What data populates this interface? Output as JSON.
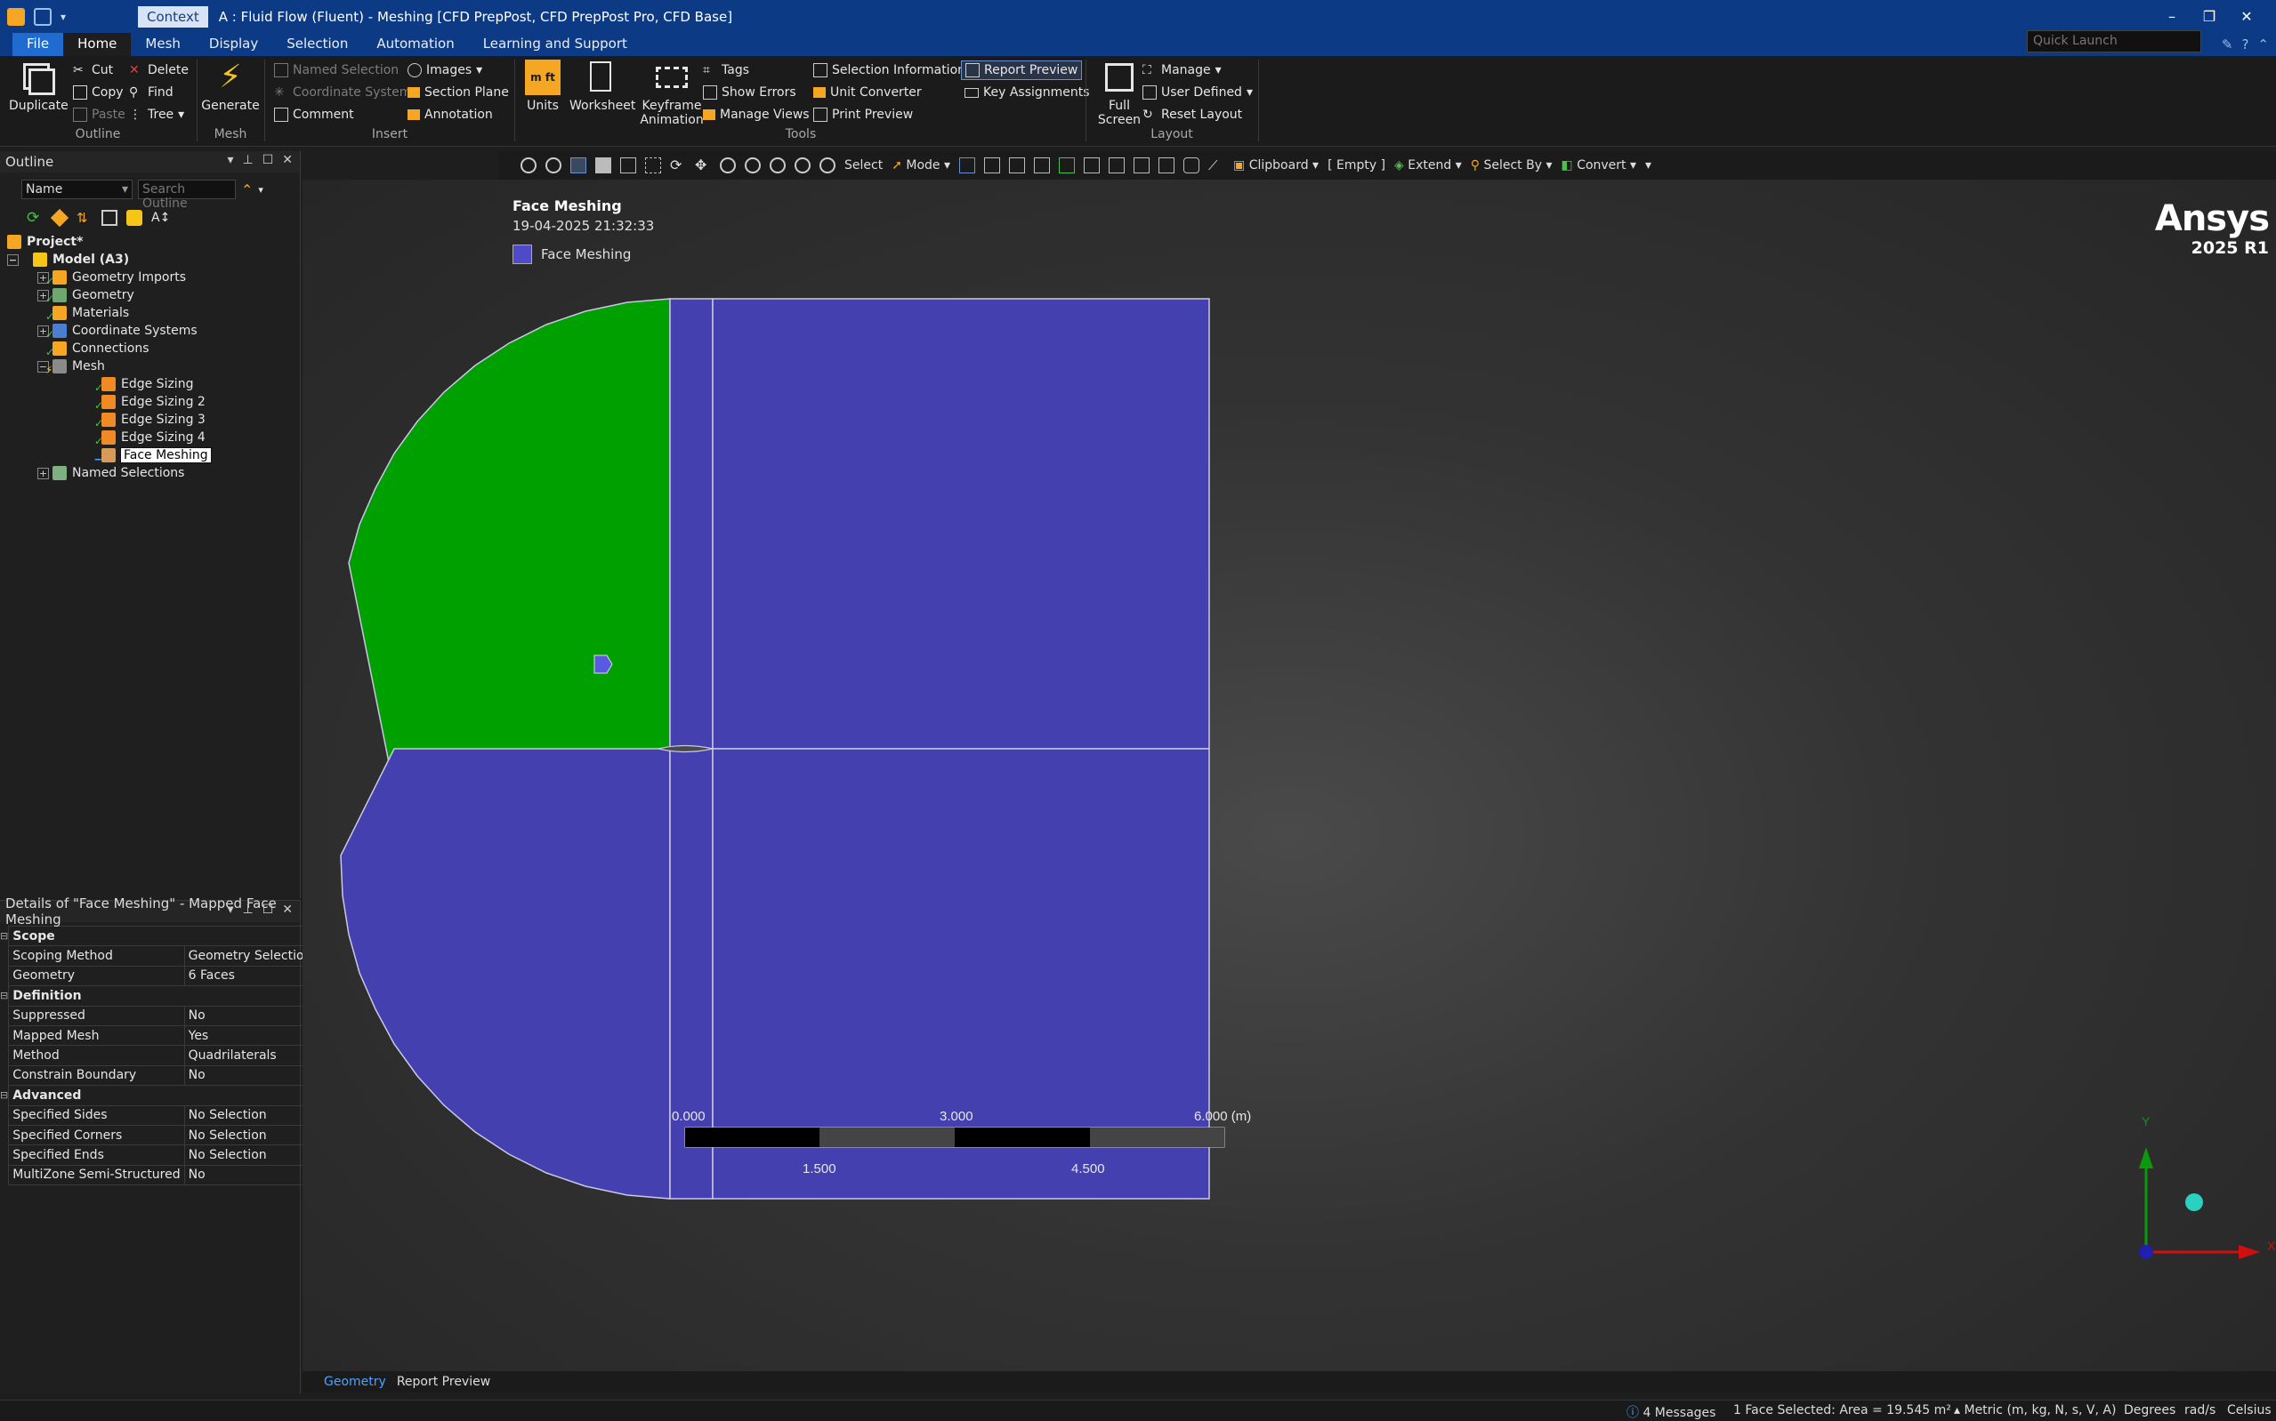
{
  "window": {
    "context": "Context",
    "title": "A : Fluid Flow (Fluent) - Meshing [CFD PrepPost, CFD PrepPost Pro, CFD Base]",
    "minimize": "–",
    "restore": "❐",
    "close": "✕"
  },
  "tabs": [
    "File",
    "Home",
    "Mesh",
    "Display",
    "Selection",
    "Automation",
    "Learning and Support"
  ],
  "quick_launch": {
    "placeholder": "Quick Launch"
  },
  "ribbon": {
    "outline": {
      "label": "Outline",
      "duplicate": "Duplicate",
      "cut": "Cut",
      "copy": "Copy",
      "paste": "Paste",
      "delete": "Delete",
      "find": "Find",
      "tree": "Tree"
    },
    "mesh": {
      "label": "Mesh",
      "generate": "Generate"
    },
    "insert": {
      "label": "Insert",
      "named_selection": "Named Selection",
      "coordinate_system": "Coordinate System",
      "comment": "Comment",
      "images": "Images",
      "section_plane": "Section Plane",
      "annotation": "Annotation"
    },
    "tools": {
      "label": "Tools",
      "units": "Units",
      "units_glyph": "m ft",
      "worksheet": "Worksheet",
      "keyframe_1": "Keyframe",
      "keyframe_2": "Animation",
      "tags": "Tags",
      "show_errors": "Show Errors",
      "manage_views": "Manage Views",
      "selection_information": "Selection Information",
      "unit_converter": "Unit Converter",
      "print_preview": "Print Preview",
      "report_preview": "Report Preview",
      "key_assignments": "Key Assignments"
    },
    "layout": {
      "label": "Layout",
      "full_screen_1": "Full",
      "full_screen_2": "Screen",
      "manage": "Manage",
      "user_defined": "User Defined",
      "reset_layout": "Reset Layout"
    }
  },
  "outline_panel": {
    "title": "Outline",
    "filter_value": "Name",
    "search_placeholder": "Search Outline",
    "tree": [
      {
        "label": "Project*",
        "level": 0,
        "bold": true
      },
      {
        "label": "Model (A3)",
        "level": 1,
        "bold": true
      },
      {
        "label": "Geometry Imports",
        "level": 2
      },
      {
        "label": "Geometry",
        "level": 2
      },
      {
        "label": "Materials",
        "level": 2
      },
      {
        "label": "Coordinate Systems",
        "level": 2
      },
      {
        "label": "Connections",
        "level": 2
      },
      {
        "label": "Mesh",
        "level": 2
      },
      {
        "label": "Edge Sizing",
        "level": 3
      },
      {
        "label": "Edge Sizing 2",
        "level": 3
      },
      {
        "label": "Edge Sizing 3",
        "level": 3
      },
      {
        "label": "Edge Sizing 4",
        "level": 3
      },
      {
        "label": "Face Meshing",
        "level": 3,
        "selected": true
      },
      {
        "label": "Named Selections",
        "level": 2
      }
    ]
  },
  "details_panel": {
    "title": "Details of \"Face Meshing\" - Mapped Face Meshing",
    "rows": [
      {
        "section": "Scope"
      },
      {
        "name": "Scoping Method",
        "value": "Geometry Selection"
      },
      {
        "name": "Geometry",
        "value": "6 Faces"
      },
      {
        "section": "Definition"
      },
      {
        "name": "Suppressed",
        "value": "No"
      },
      {
        "name": "Mapped Mesh",
        "value": "Yes"
      },
      {
        "name": "Method",
        "value": "Quadrilaterals"
      },
      {
        "name": "Constrain Boundary",
        "value": "No"
      },
      {
        "section": "Advanced"
      },
      {
        "name": "Specified Sides",
        "value": "No Selection"
      },
      {
        "name": "Specified Corners",
        "value": "No Selection"
      },
      {
        "name": "Specified Ends",
        "value": "No Selection"
      },
      {
        "name": "MultiZone Semi-Structured",
        "value": "No"
      }
    ]
  },
  "viewport_toolbar": {
    "select": "Select",
    "mode": "Mode",
    "clipboard": "Clipboard",
    "empty": "[ Empty ]",
    "extend": "Extend",
    "select_by": "Select By",
    "convert": "Convert"
  },
  "viewport": {
    "title": "Face Meshing",
    "date": "19-04-2025 21:32:33",
    "legend_label": "Face Meshing",
    "brand_1": "Ansys",
    "brand_2": "2025 R1",
    "colors": {
      "green": "#00a000",
      "blue": "#4540b0",
      "edge": "#c8c8e6"
    },
    "scale": {
      "top_labels": [
        "0.000",
        "3.000",
        "6.000 (m)"
      ],
      "bottom_labels": [
        "1.500",
        "4.500"
      ]
    },
    "triad": {
      "y": "Y",
      "x": "X"
    }
  },
  "viewport_tabs": [
    "Geometry",
    "Report Preview"
  ],
  "status": {
    "messages": "4 Messages",
    "selection": "1 Face Selected: Area = 19.545 m²",
    "units": "Metric (m, kg, N, s, V, A)",
    "angle": "Degrees",
    "rate": "rad/s",
    "temp": "Celsius"
  }
}
